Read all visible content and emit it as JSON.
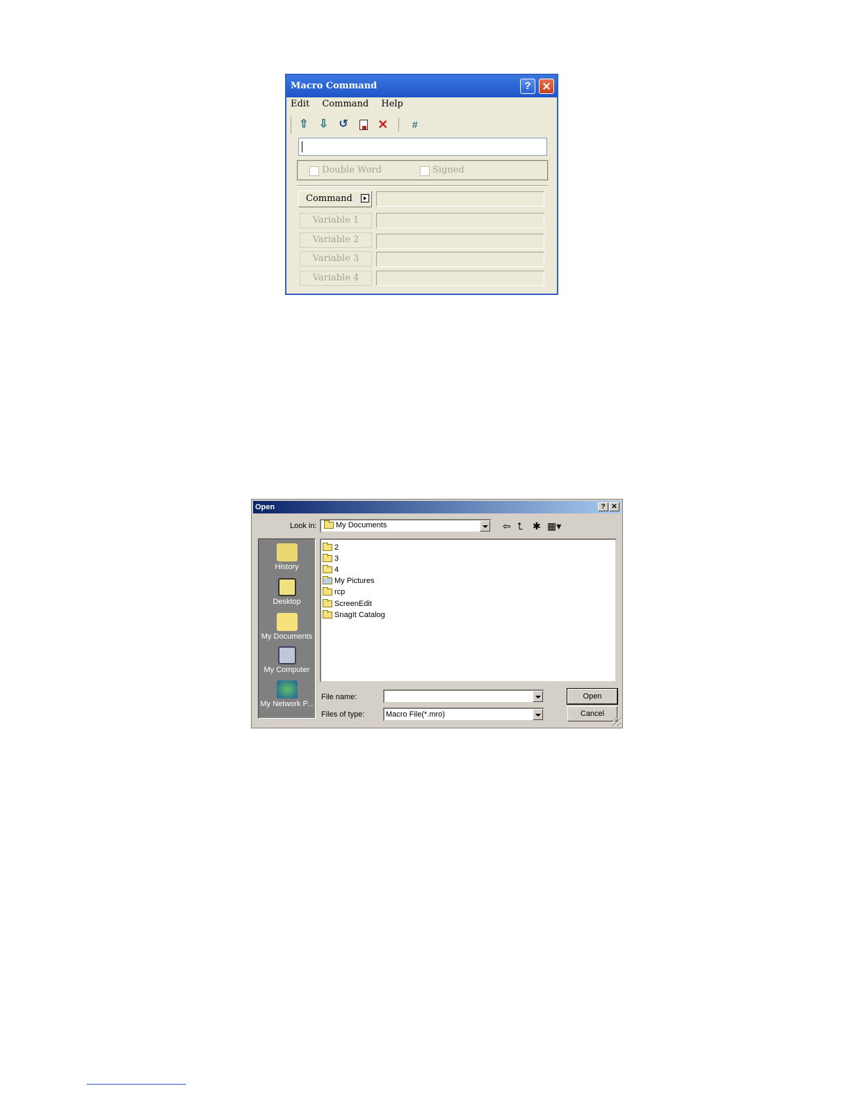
{
  "macro_dialog": {
    "title": "Macro Command",
    "menu": [
      "Edit",
      "Command",
      "Help"
    ],
    "toolbar_icons": [
      "move-up-icon",
      "move-down-icon",
      "refresh-icon",
      "document-icon",
      "delete-icon",
      "hash-icon"
    ],
    "hash_symbol": "#",
    "command_input_value": "",
    "options": {
      "double_word": "Double Word",
      "signed": "Signed"
    },
    "rows": [
      {
        "label": "Command",
        "enabled": true
      },
      {
        "label": "Variable 1",
        "enabled": false
      },
      {
        "label": "Variable 2",
        "enabled": false
      },
      {
        "label": "Variable 3",
        "enabled": false
      },
      {
        "label": "Variable 4",
        "enabled": false
      }
    ],
    "colors": {
      "titlebar": "#2a62d8",
      "body": "#ece9d8"
    }
  },
  "open_dialog": {
    "title": "Open",
    "look_in_label": "Look in:",
    "look_in_value": "My Documents",
    "places": [
      "History",
      "Desktop",
      "My Documents",
      "My Computer",
      "My Network P..."
    ],
    "files": [
      "2",
      "3",
      "4",
      "My Pictures",
      "rcp",
      "ScreenEdit",
      "SnagIt Catalog"
    ],
    "file_name_label": "File name:",
    "file_name_value": "",
    "files_of_type_label": "Files of type:",
    "files_of_type_value": "Macro File(*.mro)",
    "buttons": {
      "open": "Open",
      "cancel": "Cancel"
    },
    "colors": {
      "titlebar_start": "#0a246a",
      "titlebar_end": "#a6caf0",
      "body": "#d4d0c8"
    }
  }
}
